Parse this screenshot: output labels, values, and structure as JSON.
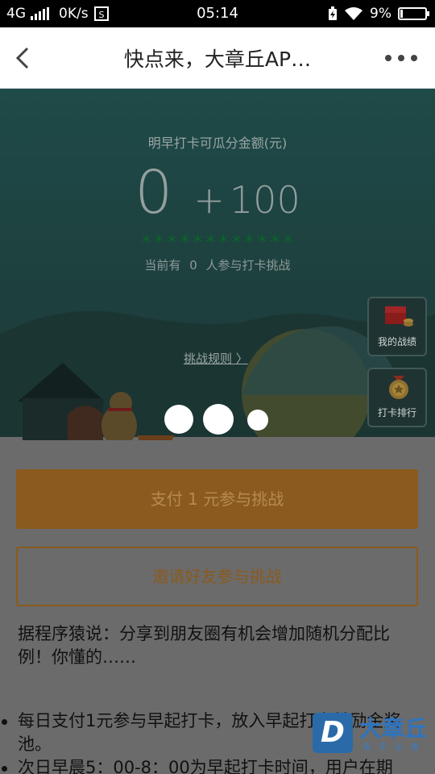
{
  "status_bar": {
    "network": "4G",
    "speed": "0K/s",
    "time": "05:14",
    "battery_percent": "9%",
    "battery_level": 0.09,
    "icons": [
      "signal-icon",
      "screenshot-icon",
      "battery-saver-icon",
      "wifi-icon",
      "battery-icon"
    ]
  },
  "nav": {
    "title": "快点来，大章丘AP…",
    "back_icon": "chevron-left-icon",
    "more_icon": "more-dots-icon"
  },
  "hero": {
    "amount_caption": "明早打卡可瓜分金额(元)",
    "amount_base": "0",
    "amount_plus": "+",
    "amount_bonus": "100",
    "green_tip": "＊＊＊＊＊＊＊＊＊＊＊＊",
    "participants_prefix": "当前有",
    "participants_count": "0",
    "participants_suffix": "人参与打卡挑战",
    "rules_link": "挑战规则 〉",
    "side_buttons": [
      {
        "label": "我的战绩",
        "icon": "red-envelope-coins-icon"
      },
      {
        "label": "打卡排行",
        "icon": "medal-icon"
      }
    ]
  },
  "actions": {
    "pay_button": "支付 1 元参与挑战",
    "invite_button": "邀请好友参与挑战"
  },
  "note": "据程序猿说：分享到朋友圈有机会增加随机分配比例！你懂的……",
  "rules": [
    "每日支付1元参与早起打卡，放入早起打卡鼓励金奖池。",
    "次日早晨5：00-8：00为早起打卡时间，用户在期"
  ],
  "watermark": {
    "logo_letter": "D",
    "title": "大章丘",
    "subtitle": "每天必看"
  },
  "colors": {
    "overlay": "#6b6b6b",
    "hero_sky": "#1e4a48",
    "accent_orange": "#8a5a1e"
  }
}
